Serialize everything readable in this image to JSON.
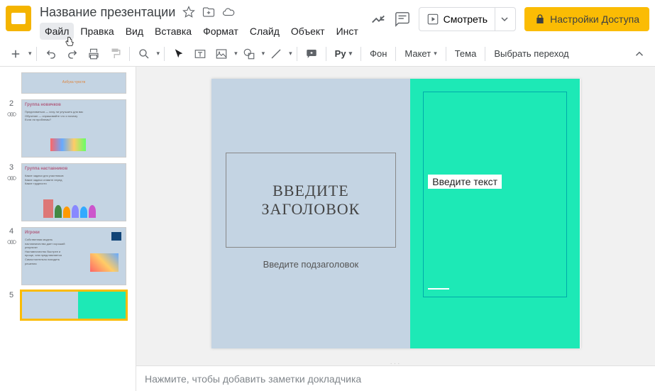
{
  "doc": {
    "title": "Название презентации"
  },
  "menu": {
    "file": "Файл",
    "edit": "Правка",
    "view": "Вид",
    "insert": "Вставка",
    "format": "Формат",
    "slide": "Слайд",
    "object": "Объект",
    "tools": "Инст"
  },
  "header": {
    "watch": "Смотреть",
    "share": "Настройки Доступа"
  },
  "toolbar": {
    "background": "Фон",
    "layout": "Макет",
    "theme": "Тема",
    "transition": "Выбрать переход"
  },
  "slides": {
    "s1": {
      "num": ""
    },
    "s2": {
      "num": "2",
      "title": "Группа новичков"
    },
    "s3": {
      "num": "3",
      "title": "Группа наставников"
    },
    "s4": {
      "num": "4",
      "title": "Игроки"
    },
    "s5": {
      "num": "5"
    }
  },
  "canvas": {
    "title_placeholder": "Введите заголовок",
    "subtitle_placeholder": "Введите подзаголовок",
    "text_placeholder": "Введите текст"
  },
  "notes": {
    "placeholder": "Нажмите, чтобы добавить заметки докладчика"
  }
}
